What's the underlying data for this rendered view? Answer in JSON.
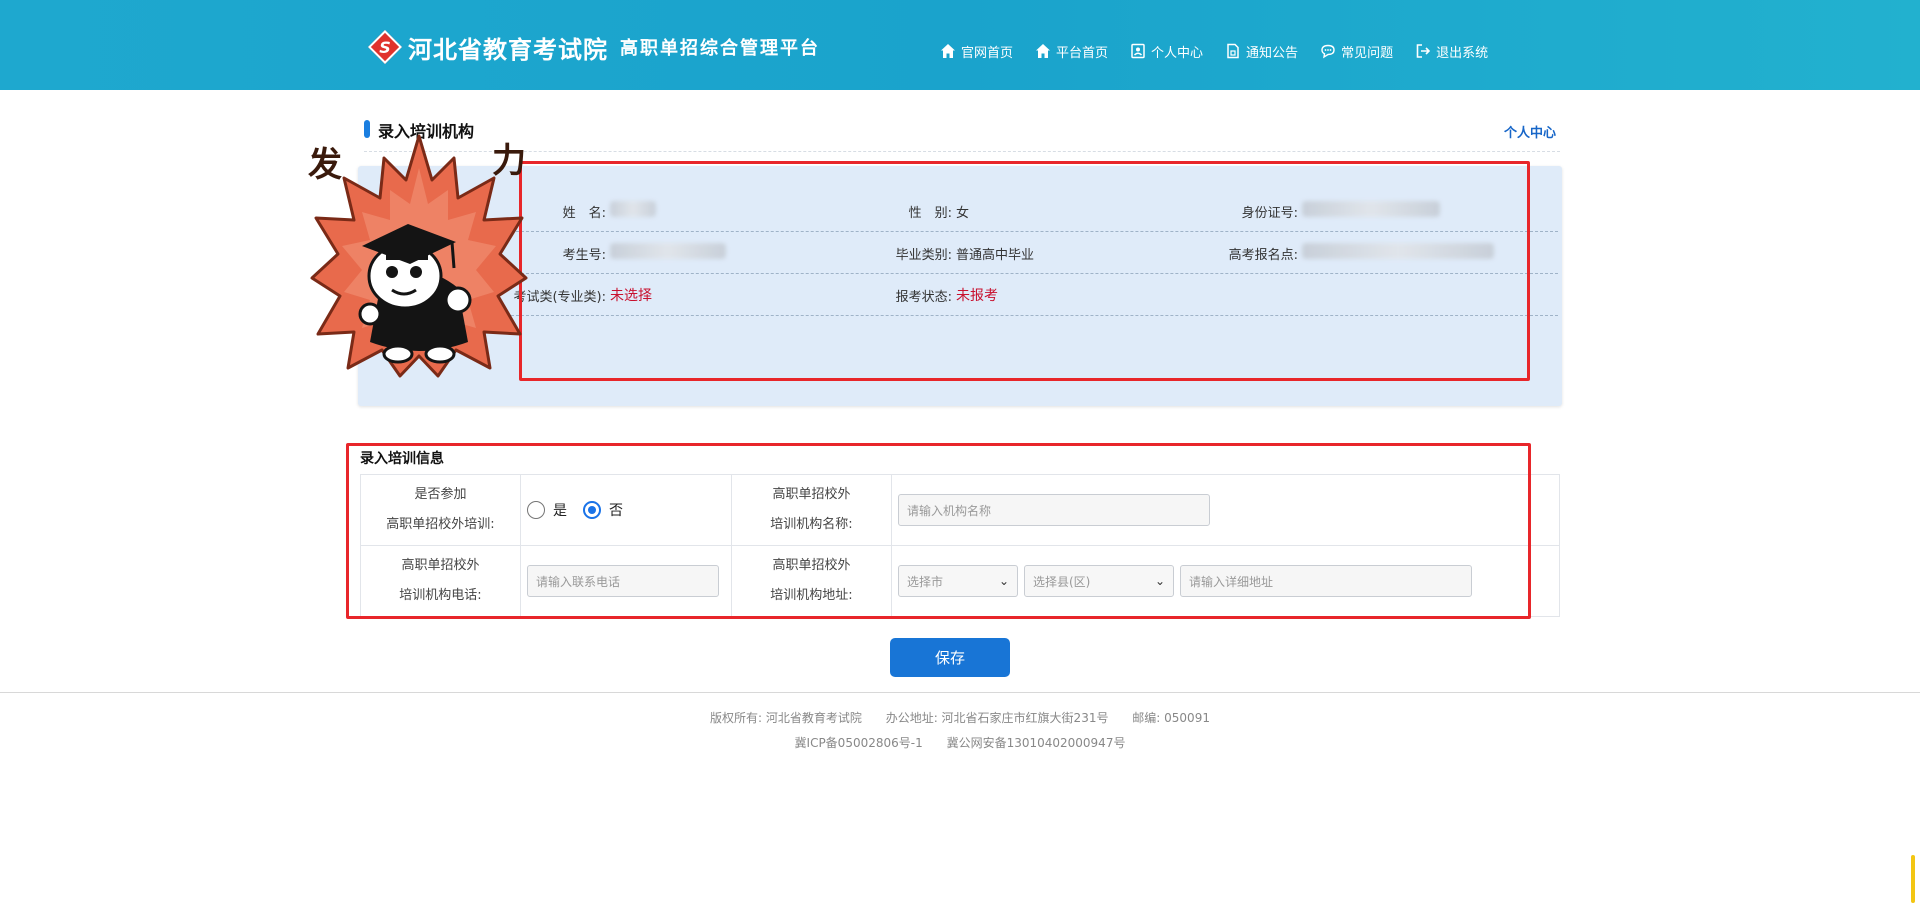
{
  "header": {
    "org_name": "河北省教育考试院",
    "platform_name": "高职单招综合管理平台",
    "logo_mark": "S",
    "nav": [
      {
        "label": "官网首页",
        "icon": "home-icon"
      },
      {
        "label": "平台首页",
        "icon": "home-icon"
      },
      {
        "label": "个人中心",
        "icon": "user-card-icon"
      },
      {
        "label": "通知公告",
        "icon": "document-icon"
      },
      {
        "label": "常见问题",
        "icon": "chat-icon"
      },
      {
        "label": "退出系统",
        "icon": "logout-icon"
      }
    ],
    "colors": {
      "header_bg": "#1ea8cf",
      "logo_red": "#e0322c"
    }
  },
  "section": {
    "title": "录入培训机构",
    "link": "个人中心"
  },
  "info": {
    "name_label": "姓　名:",
    "gender_label": "性　别:",
    "gender_value": "女",
    "id_label": "身份证号:",
    "exam_no_label": "考生号:",
    "grad_label": "毕业类别:",
    "grad_value": "普通高中毕业",
    "site_label": "高考报名点:",
    "category_label": "考试类(专业类):",
    "category_value": "未选择",
    "status_label": "报考状态:",
    "status_value": "未报考"
  },
  "mascot": {
    "text_left": "发",
    "text_right": "力"
  },
  "form": {
    "title": "录入培训信息",
    "q1_label_line1": "是否参加",
    "q1_label_line2": "高职单招校外培训:",
    "radio_yes": "是",
    "radio_no": "否",
    "selected": "否",
    "org_name_label_line1": "高职单招校外",
    "org_name_label_line2": "培训机构名称:",
    "org_name_placeholder": "请输入机构名称",
    "phone_label_line1": "高职单招校外",
    "phone_label_line2": "培训机构电话:",
    "phone_placeholder": "请输入联系电话",
    "addr_label_line1": "高职单招校外",
    "addr_label_line2": "培训机构地址:",
    "city_placeholder": "选择市",
    "county_placeholder": "选择县(区)",
    "detail_placeholder": "请输入详细地址"
  },
  "save_button": "保存",
  "footer": {
    "copyright": "版权所有: 河北省教育考试院",
    "address": "办公地址: 河北省石家庄市红旗大街231号",
    "postcode": "邮编: 050091",
    "icp": "冀ICP备05002806号-1",
    "police": "冀公网安备13010402000947号"
  }
}
